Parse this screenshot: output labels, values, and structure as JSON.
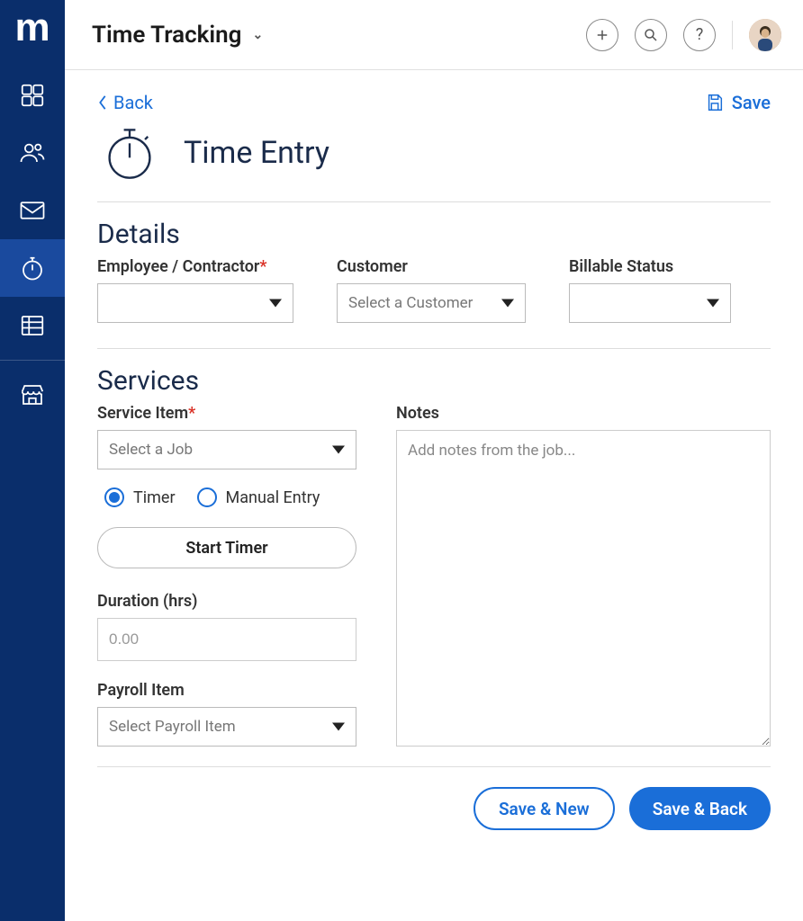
{
  "header": {
    "title": "Time Tracking"
  },
  "top": {
    "back_label": "Back",
    "save_label": "Save"
  },
  "page": {
    "title": "Time Entry"
  },
  "details": {
    "title": "Details",
    "employee_label": "Employee / Contractor",
    "customer_label": "Customer",
    "customer_placeholder": "Select a Customer",
    "billable_label": "Billable Status"
  },
  "services": {
    "title": "Services",
    "service_item_label": "Service Item",
    "service_item_placeholder": "Select a Job",
    "notes_label": "Notes",
    "notes_placeholder": "Add notes from the job...",
    "radio_timer": "Timer",
    "radio_manual": "Manual Entry",
    "start_timer_label": "Start Timer",
    "duration_label": "Duration (hrs)",
    "duration_placeholder": "0.00",
    "payroll_label": "Payroll Item",
    "payroll_placeholder": "Select Payroll Item"
  },
  "footer": {
    "save_new": "Save & New",
    "save_back": "Save & Back"
  }
}
